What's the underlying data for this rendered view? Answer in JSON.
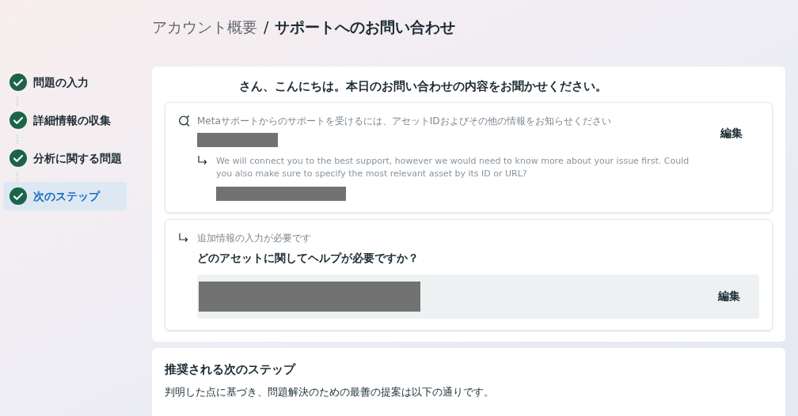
{
  "breadcrumb": {
    "parent": "アカウント概要",
    "separator": "/",
    "current": "サポートへのお問い合わせ"
  },
  "steps": [
    {
      "label": "問題の入力",
      "done": true,
      "selected": false
    },
    {
      "label": "詳細情報の収集",
      "done": true,
      "selected": false
    },
    {
      "label": "分析に関する問題",
      "done": true,
      "selected": false
    },
    {
      "label": "次のステップ",
      "done": true,
      "selected": true
    }
  ],
  "greeting": "さん、こんにちは。本日のお問い合わせの内容をお聞かせください。",
  "question_card": {
    "prompt": "Metaサポートからのサポートを受けるには、アセットIDおよびその他の情報をお知らせください",
    "edit": "編集",
    "followup": "We will connect you to the best support, however we would need to know more about your issue first. Could you also make sure to specify the most relevant asset by its ID or URL?"
  },
  "asset_card": {
    "note": "追加情報の入力が必要です",
    "question": "どのアセットに関してヘルプが必要ですか？",
    "edit": "編集"
  },
  "next_steps": {
    "title": "推奨される次のステップ",
    "description": "判明した点に基づき、問題解決のための最善の提案は以下の通りです。"
  }
}
